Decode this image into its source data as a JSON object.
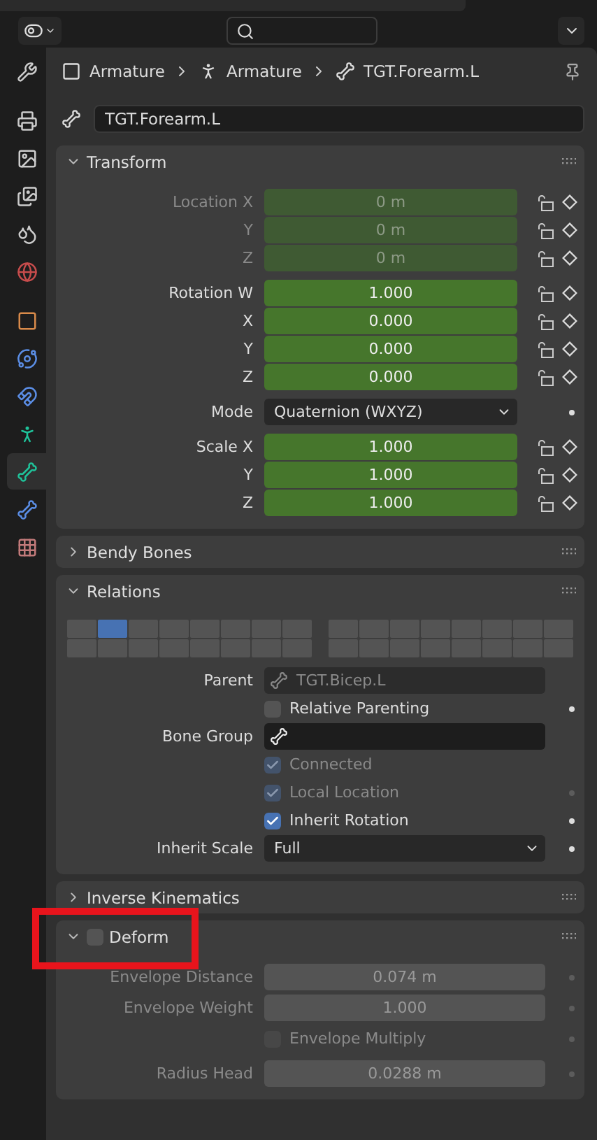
{
  "tabs": [
    {
      "selected": false
    },
    {
      "selected": false
    },
    {
      "selected": false
    },
    {
      "selected": false
    },
    {
      "selected": false
    },
    {
      "selected": false
    },
    {
      "selected": false
    },
    {
      "selected": false
    },
    {
      "selected": false
    },
    {
      "selected": false
    },
    {
      "selected": true
    },
    {
      "selected": false
    },
    {
      "selected": false
    }
  ],
  "breadcrumb": [
    "Armature",
    "Armature",
    "TGT.Forearm.L"
  ],
  "name_field": {
    "value": "TGT.Forearm.L"
  },
  "sections": [
    {
      "title": "Transform",
      "expanded": true,
      "groups": [
        [
          {
            "kind": "number",
            "label": "Location X",
            "value": "0 m",
            "keyed": true,
            "disabled": true,
            "lock": {
              "locked": false
            },
            "keyframe": {
              "set": false
            }
          },
          {
            "kind": "number",
            "label": "Y",
            "value": "0 m",
            "keyed": true,
            "disabled": true,
            "lock": {
              "locked": false
            },
            "keyframe": {
              "set": false
            }
          },
          {
            "kind": "number",
            "label": "Z",
            "value": "0 m",
            "keyed": true,
            "disabled": true,
            "lock": {
              "locked": false
            },
            "keyframe": {
              "set": false
            }
          }
        ],
        [
          {
            "kind": "number",
            "label": "Rotation W",
            "value": "1.000",
            "keyed": true,
            "disabled": false,
            "lock": {
              "locked": false
            },
            "keyframe": {
              "set": false
            }
          },
          {
            "kind": "number",
            "label": "X",
            "value": "0.000",
            "keyed": true,
            "disabled": false,
            "lock": {
              "locked": false
            },
            "keyframe": {
              "set": false
            }
          },
          {
            "kind": "number",
            "label": "Y",
            "value": "0.000",
            "keyed": true,
            "disabled": false,
            "lock": {
              "locked": false
            },
            "keyframe": {
              "set": false
            }
          },
          {
            "kind": "number",
            "label": "Z",
            "value": "0.000",
            "keyed": true,
            "disabled": false,
            "lock": {
              "locked": false
            },
            "keyframe": {
              "set": false
            }
          }
        ],
        [
          {
            "kind": "dropdown",
            "label": "Mode",
            "value": "Quaternion (WXYZ)",
            "dot": {
              "disabled": false
            }
          }
        ],
        [
          {
            "kind": "number",
            "label": "Scale X",
            "value": "1.000",
            "keyed": true,
            "disabled": false,
            "lock": {
              "locked": false
            },
            "keyframe": {
              "set": false
            }
          },
          {
            "kind": "number",
            "label": "Y",
            "value": "1.000",
            "keyed": true,
            "disabled": false,
            "lock": {
              "locked": false
            },
            "keyframe": {
              "set": false
            }
          },
          {
            "kind": "number",
            "label": "Z",
            "value": "1.000",
            "keyed": true,
            "disabled": false,
            "lock": {
              "locked": false
            },
            "keyframe": {
              "set": false
            }
          }
        ]
      ]
    },
    {
      "title": "Bendy Bones",
      "expanded": false
    },
    {
      "title": "Relations",
      "expanded": true,
      "groups": [
        [
          {
            "kind": "layers",
            "layers": [
              {
                "selected": false
              },
              {
                "selected": true
              },
              {
                "selected": false
              },
              {
                "selected": false
              },
              {
                "selected": false
              },
              {
                "selected": false
              },
              {
                "selected": false
              },
              {
                "selected": false
              },
              {
                "selected": false
              },
              {
                "selected": false
              },
              {
                "selected": false
              },
              {
                "selected": false
              },
              {
                "selected": false
              },
              {
                "selected": false
              },
              {
                "selected": false
              },
              {
                "selected": false
              },
              {
                "selected": false
              },
              {
                "selected": false
              },
              {
                "selected": false
              },
              {
                "selected": false
              },
              {
                "selected": false
              },
              {
                "selected": false
              },
              {
                "selected": false
              },
              {
                "selected": false
              },
              {
                "selected": false
              },
              {
                "selected": false
              },
              {
                "selected": false
              },
              {
                "selected": false
              },
              {
                "selected": false
              },
              {
                "selected": false
              },
              {
                "selected": false
              },
              {
                "selected": false
              }
            ]
          }
        ],
        [
          {
            "kind": "field",
            "label": "Parent",
            "value": "TGT.Bicep.L",
            "disabled": true
          },
          {
            "kind": "checkbox",
            "label": "Relative Parenting",
            "checked": false,
            "disabled": false,
            "dot": {
              "disabled": false
            }
          },
          {
            "kind": "field",
            "label": "Bone Group",
            "disabled": false
          },
          {
            "kind": "checkbox",
            "label": "Connected",
            "checked": true,
            "disabled": true
          },
          {
            "kind": "checkbox",
            "label": "Local Location",
            "checked": true,
            "disabled": true,
            "dot": {
              "disabled": true
            }
          },
          {
            "kind": "checkbox",
            "label": "Inherit Rotation",
            "checked": true,
            "disabled": false,
            "dot": {
              "disabled": false
            }
          },
          {
            "kind": "dropdown",
            "label": "Inherit Scale",
            "value": "Full",
            "dot": {
              "disabled": false
            }
          }
        ]
      ]
    },
    {
      "title": "Inverse Kinematics",
      "expanded": false
    },
    {
      "title": "Deform",
      "expanded": true,
      "checkbox": {
        "checked": false
      },
      "highlighted": true,
      "groups": [
        [
          {
            "kind": "number",
            "label": "Envelope Distance",
            "value": "0.074 m",
            "keyed": false,
            "disabled": true,
            "dot": {
              "disabled": true
            }
          },
          {
            "kind": "number",
            "label": "Envelope Weight",
            "value": "1.000",
            "keyed": false,
            "disabled": true,
            "dot": {
              "disabled": true
            }
          },
          {
            "kind": "checkbox",
            "label": "Envelope Multiply",
            "checked": false,
            "disabled": true,
            "dot": {
              "disabled": true
            }
          }
        ],
        [
          {
            "kind": "number",
            "label": "Radius Head",
            "value": "0.0288 m",
            "keyed": false,
            "disabled": true,
            "dot": {
              "disabled": true
            }
          }
        ]
      ]
    }
  ]
}
